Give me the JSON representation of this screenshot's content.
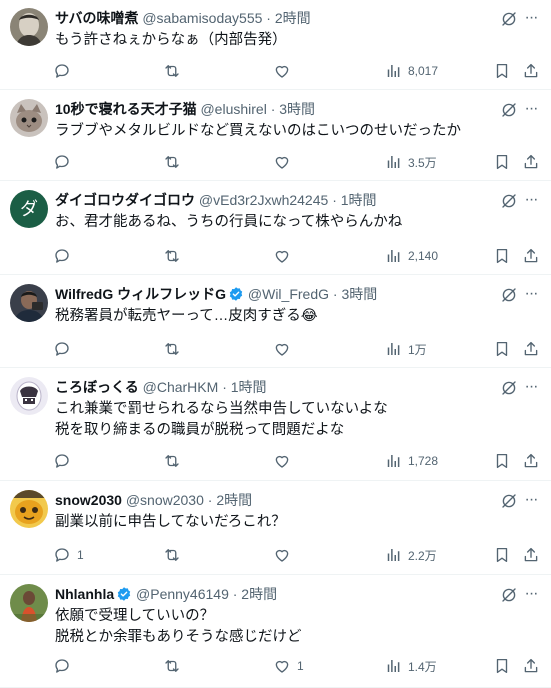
{
  "theme": {
    "name_color": "#0f1419",
    "meta_color": "#536471",
    "verified_color": "#1d9bf0",
    "divider": "#eff3f4"
  },
  "posts": [
    {
      "name": "サバの味噌煮",
      "handle": "@sabamisoday555",
      "time": "· 2時間",
      "verified": false,
      "lines": [
        "もう許さねぇからなぁ（内部告発）"
      ],
      "replies": "",
      "likes": "",
      "views": "8,017",
      "avatar": "photo-gray"
    },
    {
      "name": "10秒で寝れる天才子猫",
      "handle": "@elushirel",
      "time": "· 3時間",
      "verified": false,
      "lines": [
        "ラブブやメタルビルドなど買えないのはこいつのせいだったか"
      ],
      "replies": "",
      "likes": "",
      "views": "3.5万",
      "avatar": "cat"
    },
    {
      "name": "ダイゴロウダイゴロウ",
      "handle": "@vEd3r2Jxwh24245",
      "time": "· 1時間",
      "verified": false,
      "lines": [
        "お、君才能あるね、うちの行員になって株やらんかね"
      ],
      "replies": "",
      "likes": "",
      "views": "2,140",
      "avatar": "letter",
      "avatar_letter": "ダ"
    },
    {
      "name": "WilfredG ウィルフレッドG",
      "handle": "@Wil_FredG",
      "time": "· 3時間",
      "verified": true,
      "lines": [
        "税務署員が転売ヤーって…皮肉すぎる😂"
      ],
      "replies": "",
      "likes": "",
      "views": "1万",
      "avatar": "person-dark"
    },
    {
      "name": "ころぼっくる",
      "handle": "@CharHKM",
      "time": "· 1時間",
      "verified": false,
      "lines": [
        "これ兼業で罰せられるなら当然申告していないよな",
        "税を取り締まるの職員が脱税って問題だよな"
      ],
      "replies": "",
      "likes": "",
      "views": "1,728",
      "avatar": "character"
    },
    {
      "name": "snow2030",
      "handle": "@snow2030",
      "time": "· 2時間",
      "verified": false,
      "lines": [
        "副業以前に申告してないだろこれ？"
      ],
      "replies": "1",
      "likes": "",
      "views": "2.2万",
      "avatar": "yellow"
    },
    {
      "name": "Nhlanhla",
      "handle": "@Penny46149",
      "time": "· 2時間",
      "verified": true,
      "lines": [
        "依願で受理していいの？",
        "脱税とか余罪もありそうな感じだけど"
      ],
      "replies": "",
      "likes": "1",
      "views": "1.4万",
      "avatar": "person-green"
    }
  ],
  "icons": {
    "grok": "grok-icon",
    "more": "more-icon",
    "reply": "reply-icon",
    "retweet": "retweet-icon",
    "like": "heart-icon",
    "views": "views-icon",
    "bookmark": "bookmark-icon",
    "share": "share-icon",
    "more_glyph": "···"
  }
}
